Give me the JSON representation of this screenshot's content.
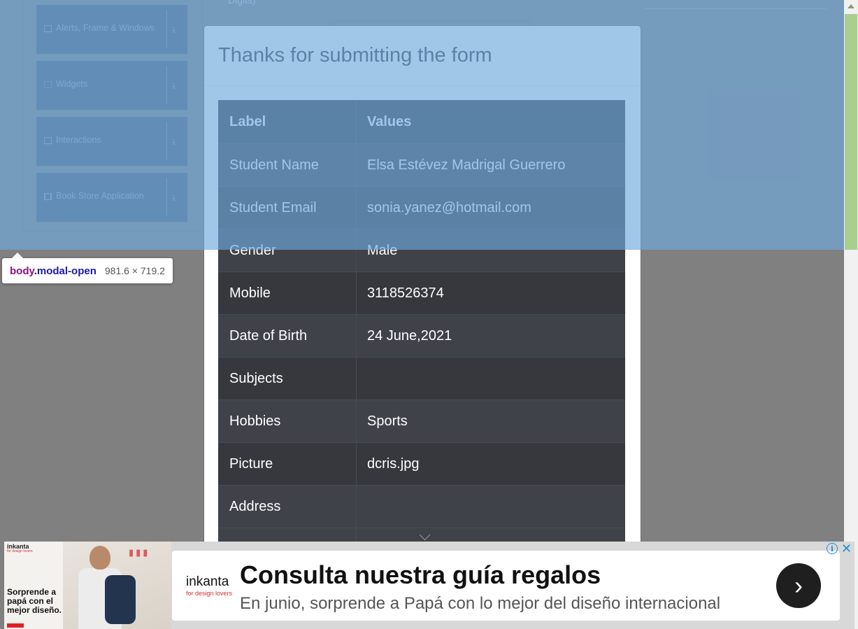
{
  "sidebar": {
    "groups": [
      {
        "label": "Alerts, Frame & Windows",
        "icon": "window-icon"
      },
      {
        "label": "Widgets",
        "icon": "widgets-icon"
      },
      {
        "label": "Interactions",
        "icon": "interactions-icon"
      },
      {
        "label": "Book Store Application",
        "icon": "book-icon"
      }
    ]
  },
  "background": {
    "hint_text": "Digits)"
  },
  "modal": {
    "title": "Thanks for submitting the form",
    "table": {
      "headers": [
        "Label",
        "Values"
      ],
      "rows": [
        {
          "label": "Student Name",
          "value": "Elsa Estévez Madrigal Guerrero"
        },
        {
          "label": "Student Email",
          "value": "sonia.yanez@hotmail.com"
        },
        {
          "label": "Gender",
          "value": "Male"
        },
        {
          "label": "Mobile",
          "value": "3118526374"
        },
        {
          "label": "Date of Birth",
          "value": "24 June,2021"
        },
        {
          "label": "Subjects",
          "value": ""
        },
        {
          "label": "Hobbies",
          "value": "Sports"
        },
        {
          "label": "Picture",
          "value": "dcris.jpg"
        },
        {
          "label": "Address",
          "value": ""
        }
      ]
    }
  },
  "devtools_tooltip": {
    "tag": "body",
    "class": ".modal-open",
    "size": "981.6 × 719.2"
  },
  "ad": {
    "brand": "inkanta",
    "brand_sub": "for design lovers",
    "left_text": "Sorprende a papá con el mejor diseño.",
    "headline": "Consulta nuestra guía regalos",
    "subline": "En junio, sorprende a Papá con lo mejor del diseño internacional",
    "info_icon": "info-icon",
    "close_icon": "close-icon",
    "go_icon": "chevron-right-icon"
  },
  "colors": {
    "highlight_overlay": "#6fa8dc",
    "table_dark": "#343a40",
    "scroll_thumb": "#a8cf8e"
  }
}
